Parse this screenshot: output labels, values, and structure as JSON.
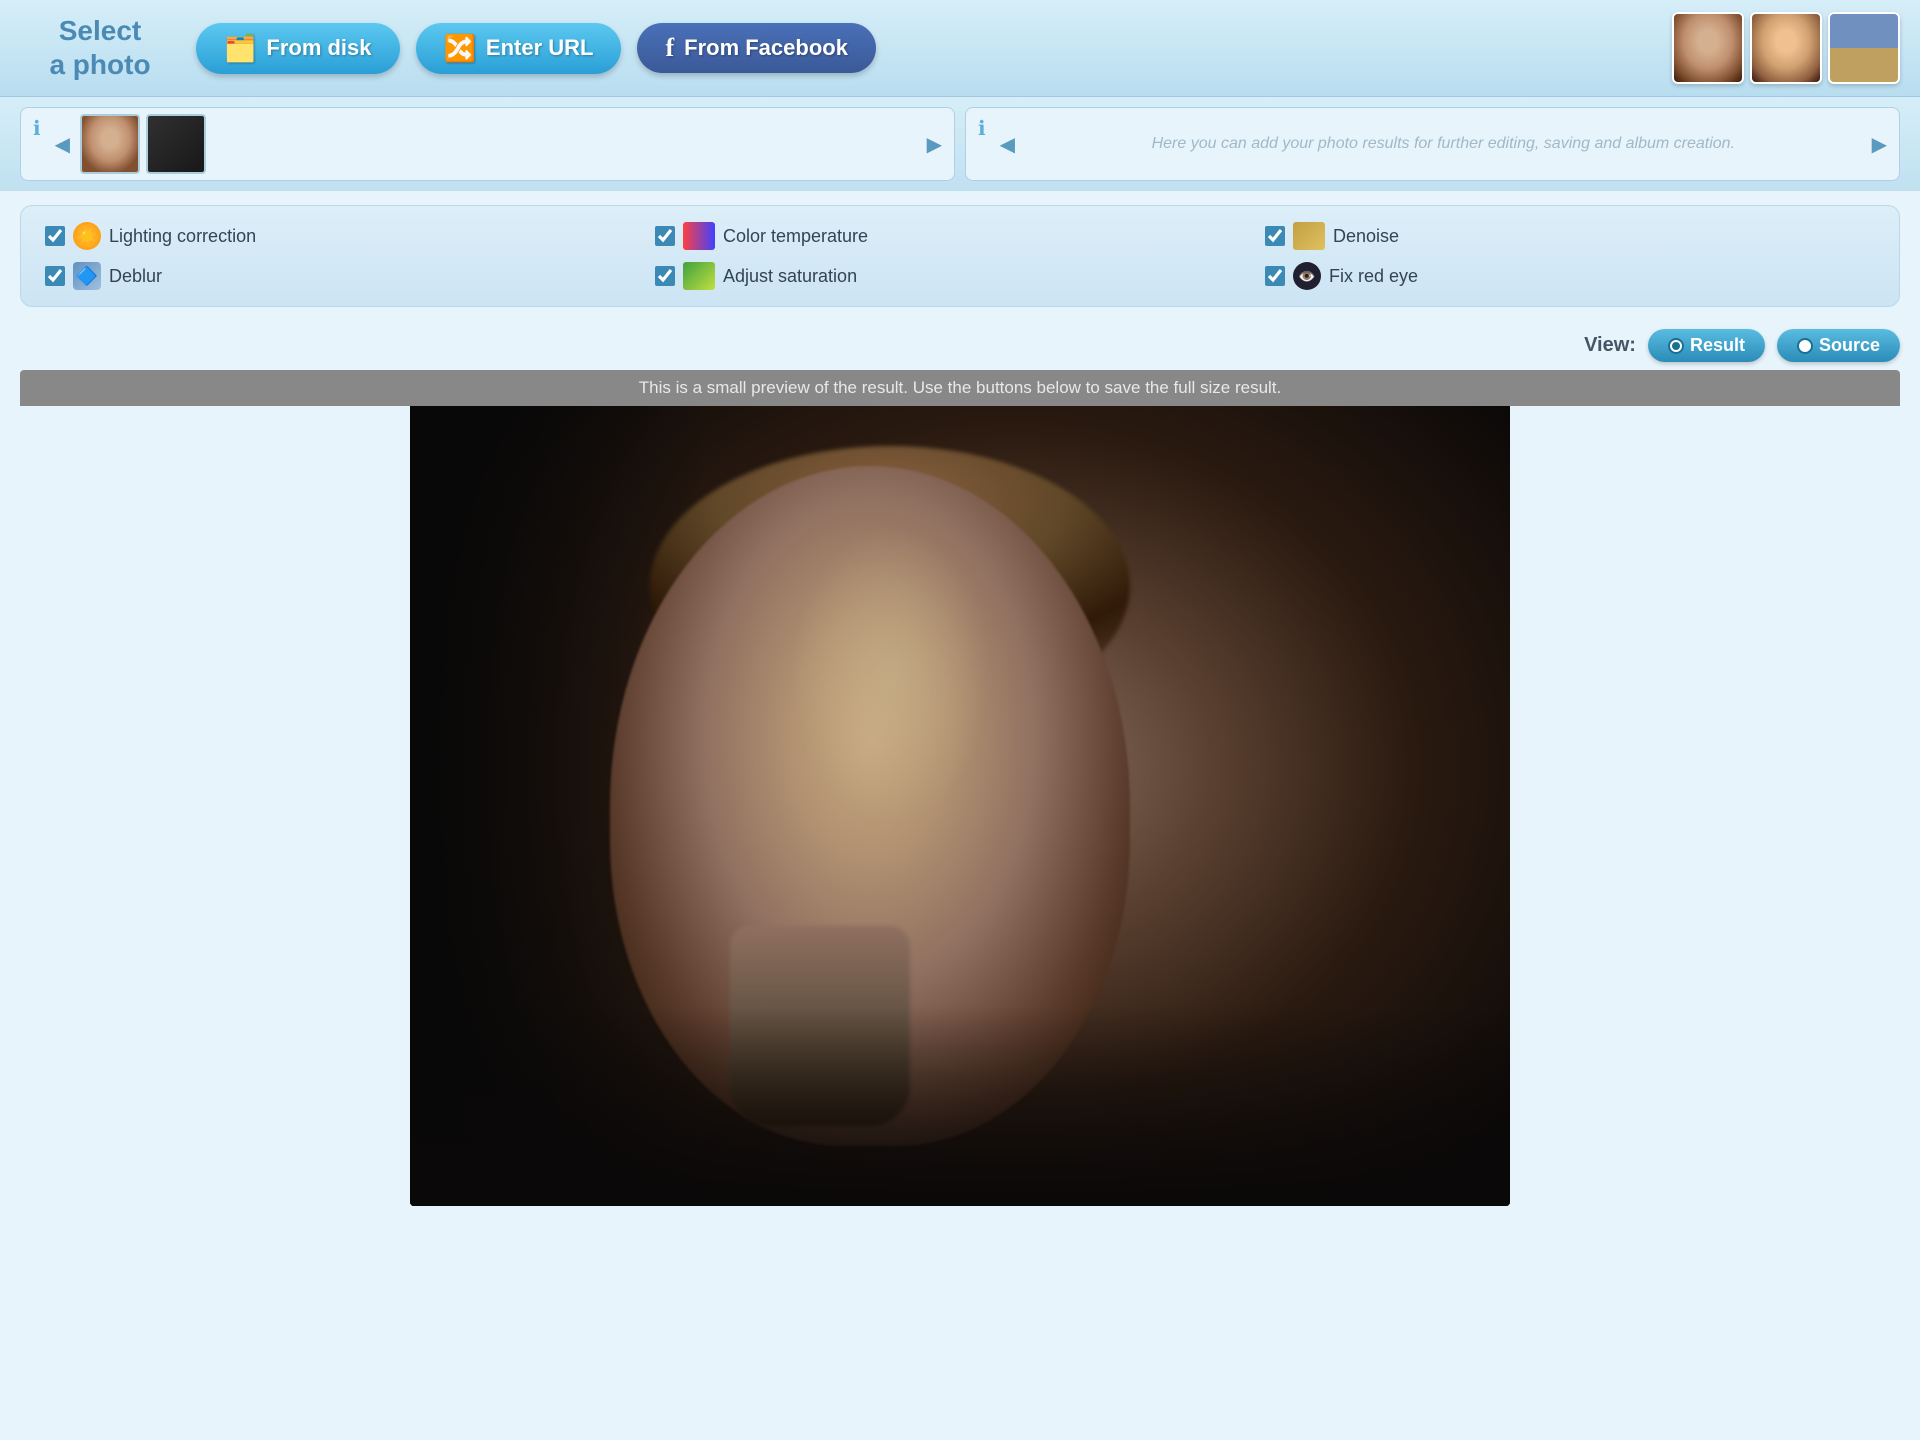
{
  "header": {
    "select_photo_line1": "Select",
    "select_photo_line2": "a photo",
    "btn_from_disk": "From disk",
    "btn_enter_url": "Enter URL",
    "btn_from_facebook": "From Facebook"
  },
  "source_panel": {
    "info_icon": "ℹ",
    "left_arrow": "◀",
    "right_arrow": "▶"
  },
  "results_panel": {
    "placeholder": "Here you can add your photo results for further editing, saving and album creation.",
    "info_icon": "ℹ",
    "left_arrow": "◀",
    "right_arrow": "▶"
  },
  "filters": {
    "lighting_correction": {
      "label": "Lighting correction",
      "checked": true
    },
    "deblur": {
      "label": "Deblur",
      "checked": true
    },
    "color_temperature": {
      "label": "Color temperature",
      "checked": true
    },
    "adjust_saturation": {
      "label": "Adjust saturation",
      "checked": true
    },
    "denoise": {
      "label": "Denoise",
      "checked": true
    },
    "fix_red_eye": {
      "label": "Fix red eye",
      "checked": true
    }
  },
  "view": {
    "label": "View:",
    "result_label": "Result",
    "source_label": "Source",
    "result_selected": true,
    "source_selected": false
  },
  "preview": {
    "notice": "This is a small preview of the result. Use the buttons below to save the full size result."
  }
}
